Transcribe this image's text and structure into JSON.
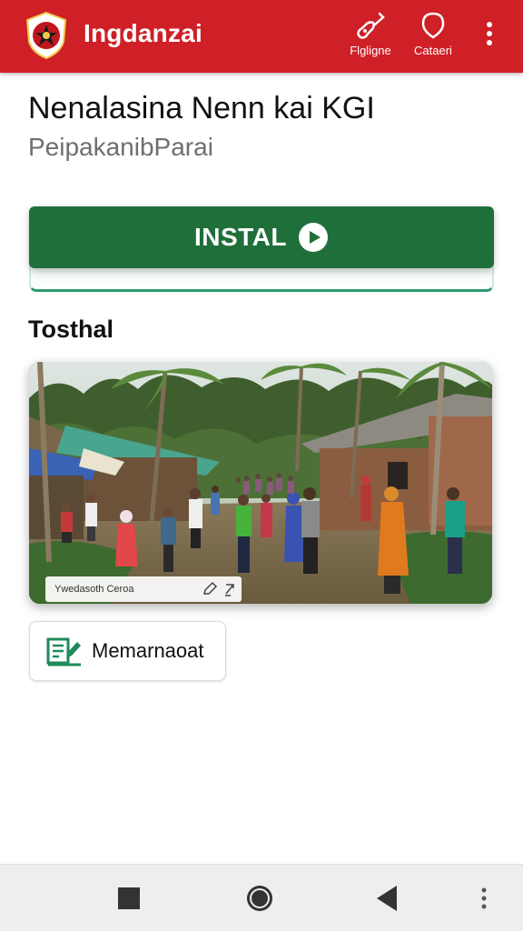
{
  "app_bar": {
    "title": "Ingdanzai",
    "background_color": "#cf1f27",
    "logo_icon": "emblem-logo-icon",
    "actions": [
      {
        "icon": "guitar-icon",
        "label": "Flgligne"
      },
      {
        "icon": "marker-icon",
        "label": "Cataeri"
      }
    ],
    "overflow_icon": "more-vert-icon"
  },
  "header": {
    "title": "Nenalasina Nenn kai KGI",
    "subtitle": "PeipakanibParai"
  },
  "install": {
    "label": "INSTAL",
    "icon": "play-circle-icon",
    "color": "#1f6f3a"
  },
  "section": {
    "title": "Tosthal"
  },
  "photo": {
    "caption": "Ywedasoth Ceroa",
    "caption_icons": [
      "edit-icon",
      "share-icon"
    ]
  },
  "secondary_button": {
    "label": "Memarnaoat",
    "icon": "document-edit-icon",
    "icon_color": "#1f8a5a"
  },
  "nav_bar": {
    "buttons": [
      "recents-square-icon",
      "home-circle-icon",
      "back-triangle-icon",
      "more-vert-icon"
    ]
  }
}
